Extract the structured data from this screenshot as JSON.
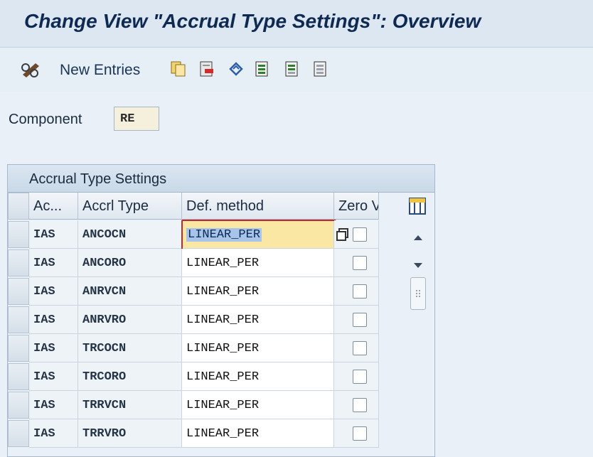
{
  "title": "Change View \"Accrual Type Settings\": Overview",
  "toolbar": {
    "new_entries_label": "New Entries",
    "icons": [
      "edit-glasses-icon",
      "copy-icon",
      "delete-icon",
      "undo-icon",
      "select-all-icon",
      "select-block-icon",
      "deselect-all-icon"
    ]
  },
  "component": {
    "label": "Component",
    "value": "RE"
  },
  "table": {
    "title": "Accrual Type Settings",
    "headers": {
      "ac": "Ac...",
      "accrl_type": "Accrl Type",
      "def_method": "Def. method",
      "zero_v": "Zero V"
    },
    "rows": [
      {
        "ac": "IAS",
        "accrl_type": "ANCOCN",
        "def_method": "LINEAR_PER",
        "zero_v": false
      },
      {
        "ac": "IAS",
        "accrl_type": "ANCORO",
        "def_method": "LINEAR_PER",
        "zero_v": false
      },
      {
        "ac": "IAS",
        "accrl_type": "ANRVCN",
        "def_method": "LINEAR_PER",
        "zero_v": false
      },
      {
        "ac": "IAS",
        "accrl_type": "ANRVRO",
        "def_method": "LINEAR_PER",
        "zero_v": false
      },
      {
        "ac": "IAS",
        "accrl_type": "TRCOCN",
        "def_method": "LINEAR_PER",
        "zero_v": false
      },
      {
        "ac": "IAS",
        "accrl_type": "TRCORO",
        "def_method": "LINEAR_PER",
        "zero_v": false
      },
      {
        "ac": "IAS",
        "accrl_type": "TRRVCN",
        "def_method": "LINEAR_PER",
        "zero_v": false
      },
      {
        "ac": "IAS",
        "accrl_type": "TRRVRO",
        "def_method": "LINEAR_PER",
        "zero_v": false
      }
    ]
  },
  "colors": {
    "title_text": "#0f2a52",
    "focus_field": "#fbe7a4",
    "focus_border": "#c42828"
  }
}
